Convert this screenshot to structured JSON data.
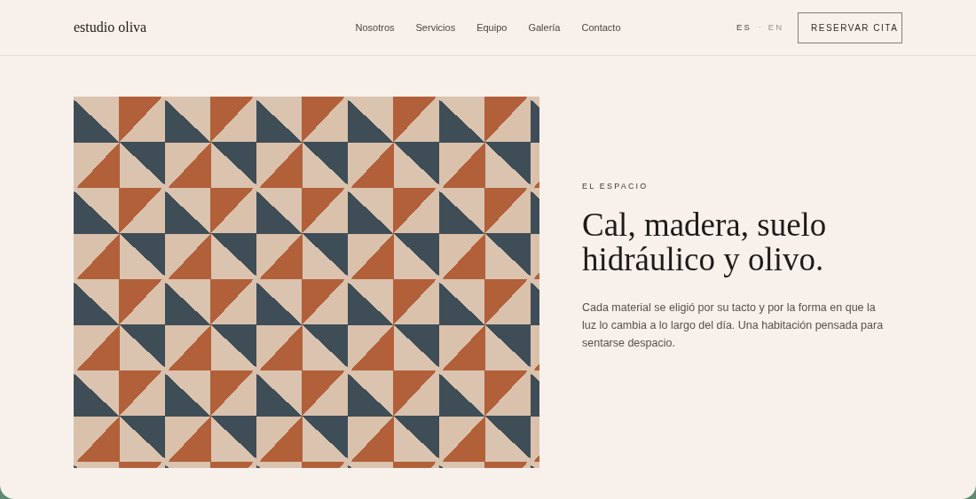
{
  "header": {
    "logo": "estudio oliva",
    "nav": [
      {
        "label": "Nosotros"
      },
      {
        "label": "Servicios"
      },
      {
        "label": "Equipo"
      },
      {
        "label": "Galería"
      },
      {
        "label": "Contacto"
      }
    ],
    "languages": [
      {
        "label": "ES",
        "selected": true
      },
      {
        "label": "EN",
        "selected": false
      }
    ],
    "language_separator": "·",
    "cta": "RESERVAR CITA"
  },
  "section": {
    "eyebrow": "EL ESPACIO",
    "heading": "Cal, madera, suelo hidráulico y olivo.",
    "body": "Cada material se eligió por su tacto y por la forma en que la luz lo cambia a lo largo del día. Una habitación pensada para sentarse despacio."
  }
}
